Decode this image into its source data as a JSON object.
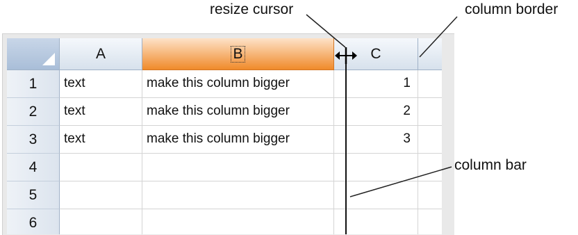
{
  "annotations": {
    "resize_cursor": "resize cursor",
    "column_border": "column border",
    "column_bar": "column bar"
  },
  "columns": [
    {
      "label": "A",
      "selected": false
    },
    {
      "label": "B",
      "selected": true
    },
    {
      "label": "C",
      "selected": false
    }
  ],
  "rows": [
    {
      "header": "1",
      "a": "text",
      "b": "make this column bigger",
      "c": "1"
    },
    {
      "header": "2",
      "a": "text",
      "b": "make this column bigger",
      "c": "2"
    },
    {
      "header": "3",
      "a": "text",
      "b": "make this column bigger",
      "c": "3"
    },
    {
      "header": "4",
      "a": "",
      "b": "",
      "c": ""
    },
    {
      "header": "5",
      "a": "",
      "b": "",
      "c": ""
    },
    {
      "header": "6",
      "a": "",
      "b": "",
      "c": ""
    }
  ],
  "colors": {
    "selected_header": "#f08a2a",
    "header": "#d7e1ec",
    "grid_line": "#d4d4d4"
  }
}
